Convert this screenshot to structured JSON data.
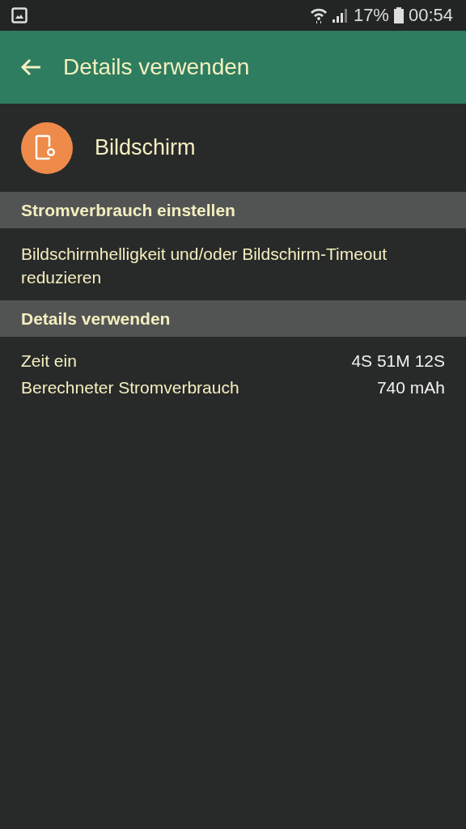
{
  "status_bar": {
    "battery": "17%",
    "time": "00:54"
  },
  "app_bar": {
    "title": "Details verwenden"
  },
  "app": {
    "name": "Bildschirm"
  },
  "sections": [
    {
      "title": "Stromverbrauch einstellen",
      "text": "Bildschirmhelligkeit und/oder Bildschirm-Timeout reduzieren"
    },
    {
      "title": "Details verwenden",
      "rows": [
        {
          "label": "Zeit ein",
          "value": "4S 51M 12S"
        },
        {
          "label": "Berechneter Stromverbrauch",
          "value": "740 mAh"
        }
      ]
    }
  ]
}
